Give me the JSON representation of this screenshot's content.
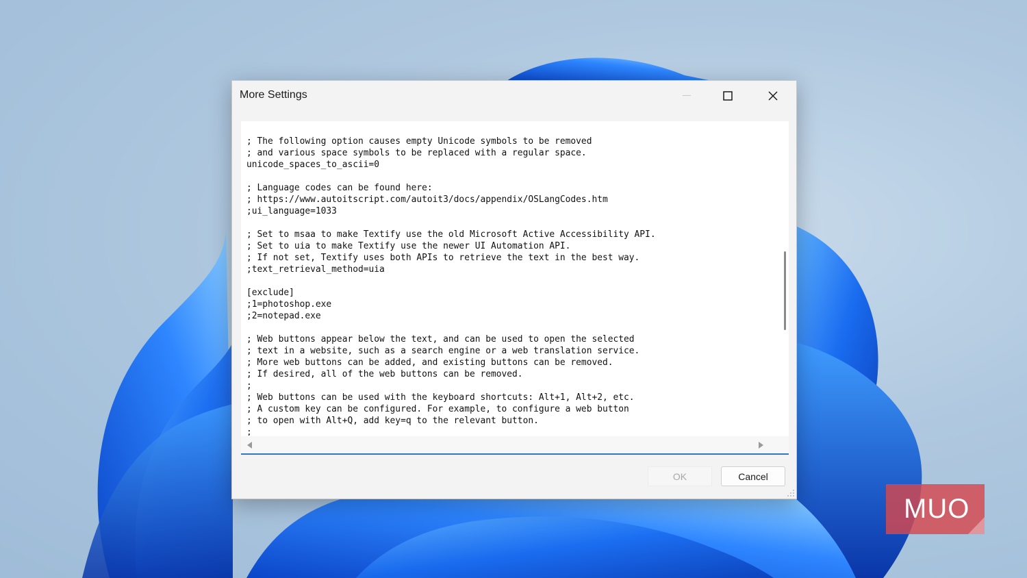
{
  "window": {
    "title": "More Settings"
  },
  "editor": {
    "lines": [
      "; The following option causes empty Unicode symbols to be removed",
      "; and various space symbols to be replaced with a regular space.",
      "unicode_spaces_to_ascii=0",
      "",
      "; Language codes can be found here:",
      "; https://www.autoitscript.com/autoit3/docs/appendix/OSLangCodes.htm",
      ";ui_language=1033",
      "",
      "; Set to msaa to make Textify use the old Microsoft Active Accessibility API.",
      "; Set to uia to make Textify use the newer UI Automation API.",
      "; If not set, Textify uses both APIs to retrieve the text in the best way.",
      ";text_retrieval_method=uia",
      "",
      "[exclude]",
      ";1=photoshop.exe",
      ";2=notepad.exe",
      "",
      "; Web buttons appear below the text, and can be used to open the selected",
      "; text in a website, such as a search engine or a web translation service.",
      "; More web buttons can be added, and existing buttons can be removed.",
      "; If desired, all of the web buttons can be removed.",
      ";",
      "; Web buttons can be used with the keyboard shortcuts: Alt+1, Alt+2, etc.",
      "; A custom key can be configured. For example, to configure a web button",
      "; to open with Alt+Q, add key=q to the relevant button.",
      ";"
    ]
  },
  "buttons": {
    "ok_label": "OK",
    "cancel_label": "Cancel"
  },
  "watermark": {
    "text": "MUO"
  },
  "icons": {
    "minimize": "minimize-icon",
    "maximize": "maximize-icon",
    "close": "close-icon",
    "scroll_left": "scroll-left-arrow-icon",
    "scroll_right": "scroll-right-arrow-icon",
    "resize_grip": "resize-grip-icon"
  },
  "colors": {
    "accent": "#2f74c7",
    "watermark": "#d6484e"
  }
}
